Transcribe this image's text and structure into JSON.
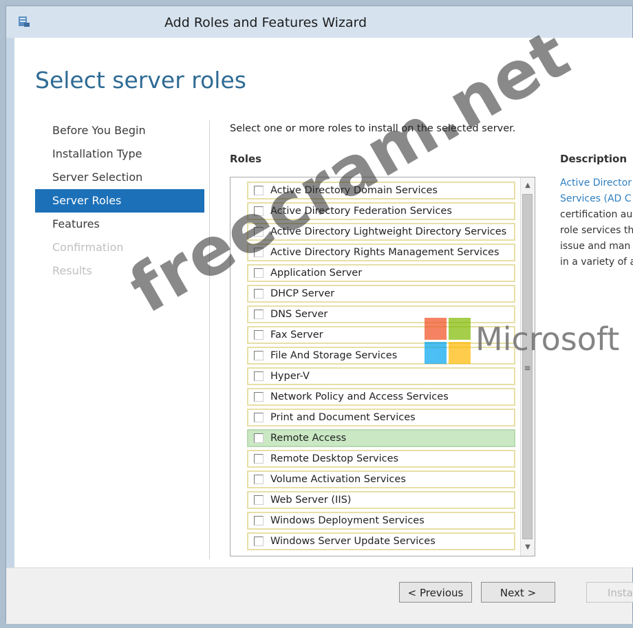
{
  "window": {
    "title": "Add Roles and Features Wizard",
    "icon": "server-manager-icon"
  },
  "page": {
    "title": "Select server roles"
  },
  "nav": {
    "items": [
      {
        "label": "Before You Begin",
        "state": "normal"
      },
      {
        "label": "Installation Type",
        "state": "normal"
      },
      {
        "label": "Server Selection",
        "state": "normal"
      },
      {
        "label": "Server Roles",
        "state": "active"
      },
      {
        "label": "Features",
        "state": "normal"
      },
      {
        "label": "Confirmation",
        "state": "disabled"
      },
      {
        "label": "Results",
        "state": "disabled"
      }
    ]
  },
  "main": {
    "instruction": "Select one or more roles to install on the selected server.",
    "roles_header": "Roles",
    "roles": [
      {
        "label": "Active Directory Domain Services",
        "checked": false
      },
      {
        "label": "Active Directory Federation Services",
        "checked": false
      },
      {
        "label": "Active Directory Lightweight Directory Services",
        "checked": false
      },
      {
        "label": "Active Directory Rights Management Services",
        "checked": false
      },
      {
        "label": "Application Server",
        "checked": false
      },
      {
        "label": "DHCP Server",
        "checked": false
      },
      {
        "label": "DNS Server",
        "checked": false
      },
      {
        "label": "Fax Server",
        "checked": false
      },
      {
        "label": "File And Storage Services",
        "checked": false
      },
      {
        "label": "Hyper-V",
        "checked": false
      },
      {
        "label": "Network Policy and Access Services",
        "checked": false
      },
      {
        "label": "Print and Document Services",
        "checked": false
      },
      {
        "label": "Remote Access",
        "checked": false,
        "selected": true
      },
      {
        "label": "Remote Desktop Services",
        "checked": false
      },
      {
        "label": "Volume Activation Services",
        "checked": false
      },
      {
        "label": "Web Server (IIS)",
        "checked": false
      },
      {
        "label": "Windows Deployment Services",
        "checked": false
      },
      {
        "label": "Windows Server Update Services",
        "checked": false
      }
    ]
  },
  "description": {
    "header": "Description",
    "lines": [
      {
        "text": "Active Director",
        "link": true
      },
      {
        "text": "Services (AD C",
        "link": true
      },
      {
        "text": "certification au",
        "link": false
      },
      {
        "text": "role services th",
        "link": false
      },
      {
        "text": "issue and man",
        "link": false
      },
      {
        "text": "in a variety of a",
        "link": false
      }
    ]
  },
  "footer": {
    "previous_label": "< Previous",
    "next_label": "Next >",
    "install_label": "Insta"
  },
  "watermark": {
    "text": "freecram.net",
    "brand": "Microsoft"
  },
  "colors": {
    "accent": "#1c70b8",
    "title": "#2f6b94",
    "link": "#2f7fc0",
    "selected_row": "#c9e8c3"
  }
}
